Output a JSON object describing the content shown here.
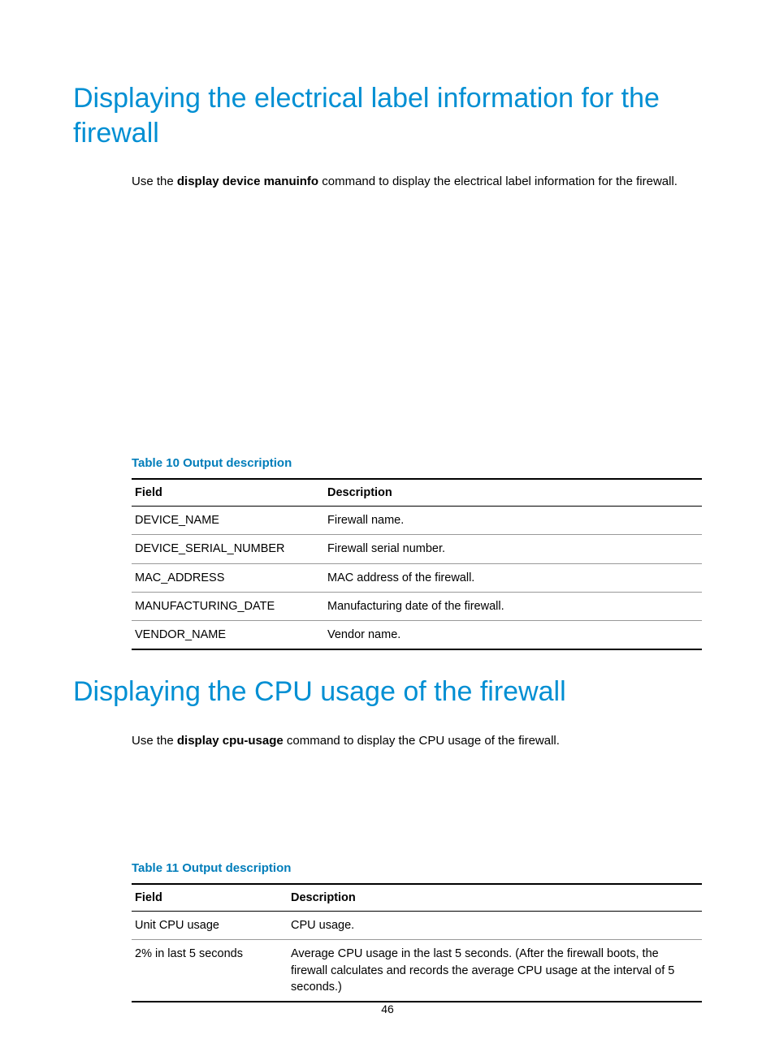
{
  "section1": {
    "heading": "Displaying the electrical label information for the firewall",
    "intro_prefix": "Use the ",
    "intro_bold": "display device manuinfo",
    "intro_suffix": " command to display the electrical label information for the firewall.",
    "table_caption": "Table 10 Output description",
    "table": {
      "headers": [
        "Field",
        "Description"
      ],
      "rows": [
        {
          "field": "DEVICE_NAME",
          "desc": "Firewall name."
        },
        {
          "field": "DEVICE_SERIAL_NUMBER",
          "desc": "Firewall serial number."
        },
        {
          "field": "MAC_ADDRESS",
          "desc": "MAC address of the firewall."
        },
        {
          "field": "MANUFACTURING_DATE",
          "desc": "Manufacturing date of the firewall."
        },
        {
          "field": "VENDOR_NAME",
          "desc": "Vendor name."
        }
      ]
    }
  },
  "section2": {
    "heading": "Displaying the CPU usage of the firewall",
    "intro_prefix": "Use the ",
    "intro_bold": "display cpu-usage",
    "intro_suffix": " command to display the CPU usage of the firewall.",
    "table_caption": "Table 11 Output description",
    "table": {
      "headers": [
        "Field",
        "Description"
      ],
      "rows": [
        {
          "field": "Unit CPU usage",
          "desc": "CPU usage."
        },
        {
          "field": "2% in last 5 seconds",
          "desc": "Average CPU usage in the last 5 seconds. (After the firewall boots, the firewall calculates and records the average CPU usage at the interval of 5 seconds.)"
        }
      ]
    }
  },
  "page_number": "46"
}
